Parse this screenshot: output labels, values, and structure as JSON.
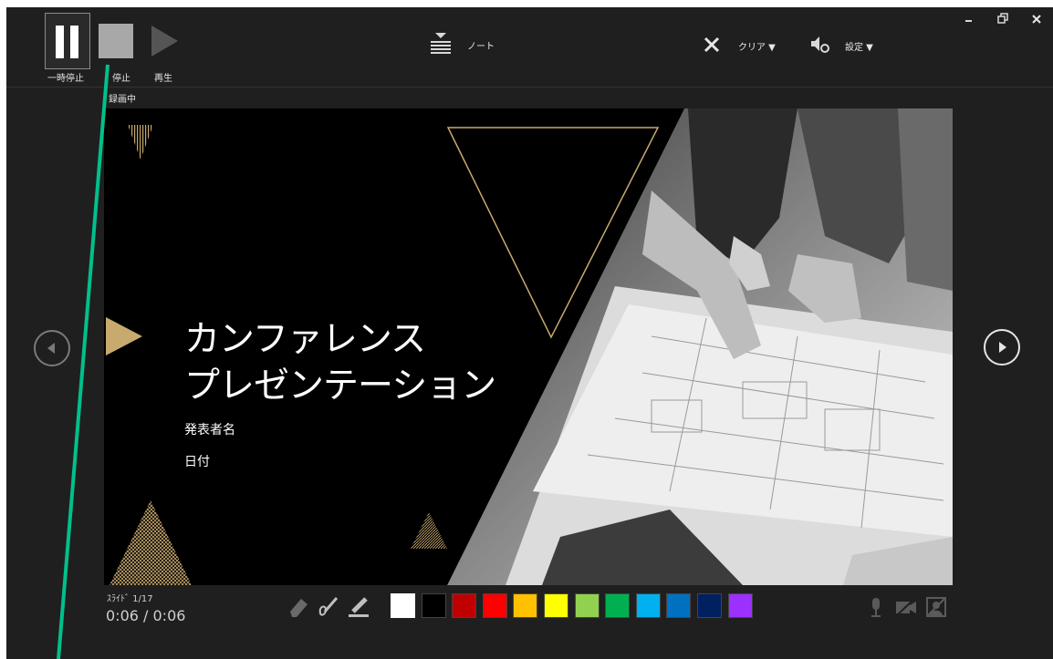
{
  "toolbar": {
    "pause_label": "一時停止",
    "stop_label": "停止",
    "play_label": "再生",
    "notes_label": "ノート",
    "clear_label": "クリア ▼",
    "settings_label": "設定 ▼",
    "recording_status": "録画中"
  },
  "slide": {
    "title_line1": "カンファレンス",
    "title_line2": "プレゼンテーション",
    "presenter": "発表者名",
    "date": "日付"
  },
  "footer": {
    "slide_counter": "ｽﾗｲﾄﾞ 1/17",
    "timer": "0:06 / 0:06"
  },
  "colors": {
    "accent_gold": "#c8a96e",
    "annotation_line": "#00c08b",
    "palette": [
      "#ffffff",
      "#000000",
      "#c00000",
      "#ff0000",
      "#ffc000",
      "#ffff00",
      "#92d050",
      "#00b050",
      "#00b0f0",
      "#0070c0",
      "#002060",
      "#9b30ff"
    ]
  },
  "icons": [
    "pause-icon",
    "stop-icon",
    "play-icon",
    "notes-icon",
    "clear-x-icon",
    "settings-speaker-icon",
    "minimize-icon",
    "restore-icon",
    "close-icon",
    "prev-slide-icon",
    "next-slide-icon",
    "eraser-icon",
    "pen-icon",
    "highlighter-icon",
    "microphone-icon",
    "camera-icon",
    "camera-preview-icon"
  ]
}
